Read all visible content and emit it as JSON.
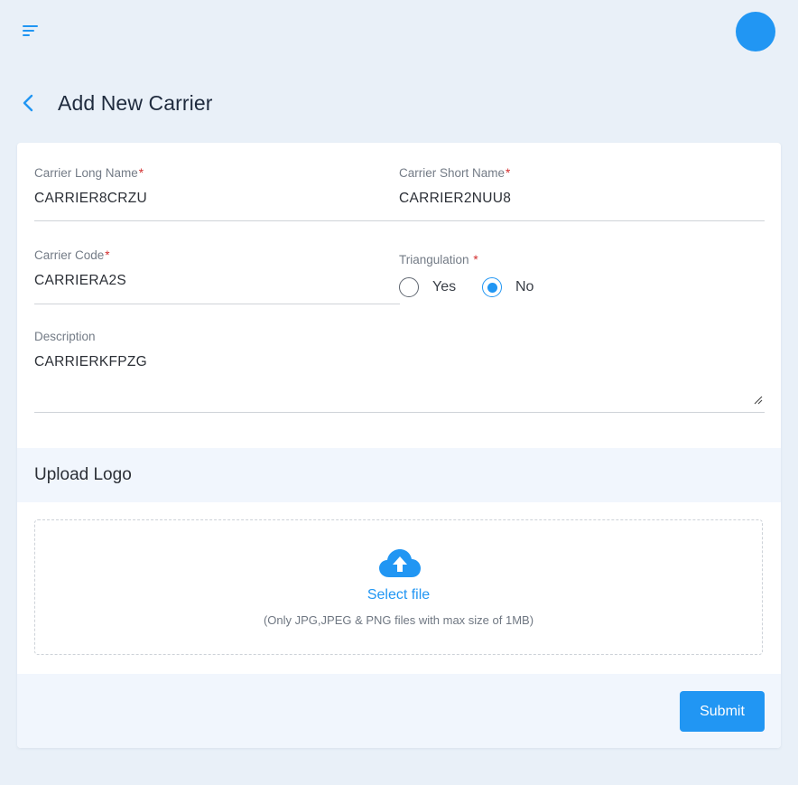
{
  "header": {
    "menu_icon": "menu-lines-icon",
    "avatar_color": "#2196f3"
  },
  "page": {
    "title": "Add New Carrier",
    "back_icon": "chevron-left-icon"
  },
  "form": {
    "long_name": {
      "label": "Carrier Long Name",
      "required": "*",
      "value": "CARRIER8CRZU"
    },
    "short_name": {
      "label": "Carrier Short Name",
      "required": "*",
      "value": "CARRIER2NUU8"
    },
    "code": {
      "label": "Carrier Code",
      "required": "*",
      "value": "CARRIERA2S"
    },
    "triangulation": {
      "label": "Triangulation",
      "required": "*",
      "options": [
        {
          "label": "Yes",
          "checked": false
        },
        {
          "label": "No",
          "checked": true
        }
      ]
    },
    "description": {
      "label": "Description",
      "value": "CARRIERKFPZG"
    }
  },
  "upload": {
    "title": "Upload Logo",
    "icon": "cloud-upload-icon",
    "select_label": "Select file",
    "hint": "(Only JPG,JPEG & PNG files with max size of 1MB)"
  },
  "actions": {
    "submit_label": "Submit"
  },
  "colors": {
    "accent": "#2196f3",
    "background": "#e9f0f8",
    "section_band": "#f1f6fd",
    "required": "#d32f2f"
  }
}
